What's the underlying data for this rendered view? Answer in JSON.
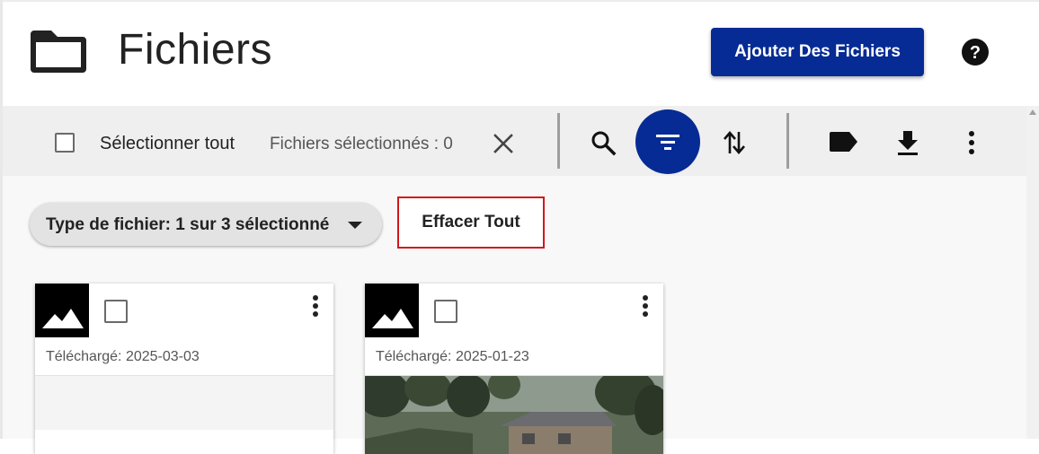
{
  "header": {
    "title": "Fichiers",
    "add_button": "Ajouter Des Fichiers",
    "icons": [
      "folder-icon",
      "help-icon"
    ]
  },
  "toolbar": {
    "select_all_label": "Sélectionner tout",
    "selected_count": "Fichiers sélectionnés : 0",
    "icons": [
      "close-icon",
      "search-icon",
      "filter-icon",
      "sort-icon",
      "label-icon",
      "download-icon",
      "more-vert-icon"
    ],
    "filter_active_color": "#062b94"
  },
  "filters": {
    "type_chip": "Type de fichier: 1 sur 3 sélectionné",
    "clear_all": "Effacer Tout",
    "clear_all_border_color": "#d3161b"
  },
  "files": [
    {
      "uploaded": "Téléchargé: 2025-03-03",
      "thumbnail": "image-icon"
    },
    {
      "uploaded": "Téléchargé: 2025-01-23",
      "thumbnail": "image-icon"
    }
  ],
  "colors": {
    "primary": "#062b94",
    "toolbar_bg": "#efefef",
    "content_bg": "#f8f8f8"
  }
}
